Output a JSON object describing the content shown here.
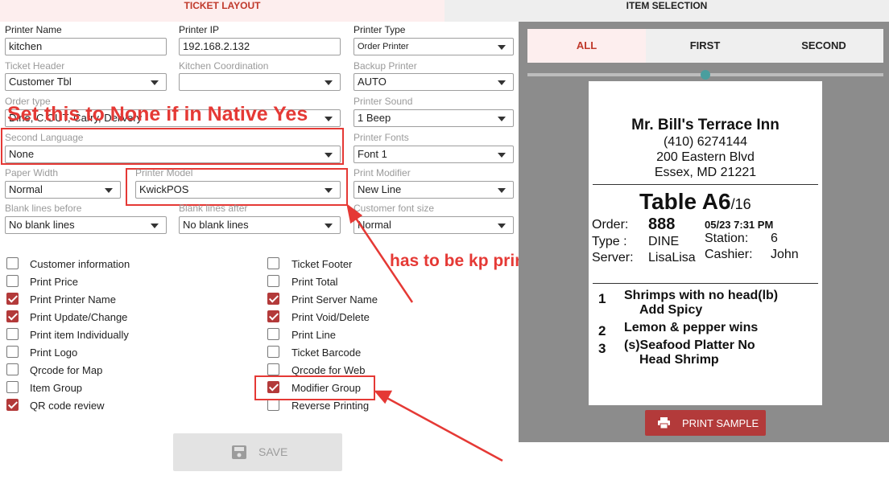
{
  "tabs": {
    "ticket_layout": "TICKET LAYOUT",
    "item_selection": "ITEM SELECTION"
  },
  "fields": {
    "printer_name": {
      "label": "Printer Name",
      "value": "kitchen"
    },
    "printer_ip": {
      "label": "Printer IP",
      "value": "192.168.2.132"
    },
    "printer_type": {
      "label": "Printer Type",
      "value": "Order Printer"
    },
    "ticket_header": {
      "label": "Ticket Header",
      "value": "Customer Tbl"
    },
    "kitchen_coordination": {
      "label": "Kitchen Coordination",
      "value": ""
    },
    "backup_printer": {
      "label": "Backup Printer",
      "value": "AUTO"
    },
    "order_type": {
      "label": "Order type",
      "value": "Dine, C.OUT, Carry, Delivery"
    },
    "printer_sound": {
      "label": "Printer Sound",
      "value": "1 Beep"
    },
    "second_language": {
      "label": "Second Language",
      "value": "None"
    },
    "printer_fonts": {
      "label": "Printer Fonts",
      "value": "Font 1"
    },
    "paper_width": {
      "label": "Paper Width",
      "value": "Normal"
    },
    "printer_model": {
      "label": "Printer Model",
      "value": "KwickPOS"
    },
    "print_modifier": {
      "label": "Print Modifier",
      "value": "New Line"
    },
    "blank_before": {
      "label": "Blank lines before",
      "value": "No blank lines"
    },
    "blank_after": {
      "label": "Blank lines after",
      "value": "No blank lines"
    },
    "customer_font": {
      "label": "Customer font size",
      "value": "Normal"
    }
  },
  "checkboxes_left": [
    {
      "label": "Customer information",
      "checked": false
    },
    {
      "label": "Print Price",
      "checked": false
    },
    {
      "label": "Print Printer Name",
      "checked": true
    },
    {
      "label": "Print Update/Change",
      "checked": true
    },
    {
      "label": "Print item Individually",
      "checked": false
    },
    {
      "label": "Print Logo",
      "checked": false
    },
    {
      "label": "Qrcode for Map",
      "checked": false
    },
    {
      "label": "Item Group",
      "checked": false
    },
    {
      "label": "QR code review",
      "checked": true
    }
  ],
  "checkboxes_right": [
    {
      "label": "Ticket Footer",
      "checked": false
    },
    {
      "label": "Print Total",
      "checked": false
    },
    {
      "label": "Print Server Name",
      "checked": true
    },
    {
      "label": "Print Void/Delete",
      "checked": true
    },
    {
      "label": "Print Line",
      "checked": false
    },
    {
      "label": "Ticket Barcode",
      "checked": false
    },
    {
      "label": "Qrcode for Web",
      "checked": false
    },
    {
      "label": "Modifier Group",
      "checked": true
    },
    {
      "label": "Reverse Printing",
      "checked": false
    }
  ],
  "save_label": "SAVE",
  "annotations": {
    "none_note": "Set this to None if in Native Yes",
    "kp_note": "has to be kp printer",
    "color": "#e53935"
  },
  "segments": [
    "ALL",
    "FIRST",
    "SECOND"
  ],
  "receipt": {
    "name": "Mr. Bill's Terrace Inn",
    "phone": "(410) 6274144",
    "address1": "200 Eastern Blvd",
    "address2": "Essex, MD 21221",
    "table": "Table A6",
    "table_suffix": "/16",
    "order_label": "Order:",
    "order_no": "888",
    "datetime": "05/23 7:31 PM",
    "type_label": "Type :",
    "type_value": "DINE",
    "station_label": "Station:",
    "station_value": "6",
    "server_label": "Server:",
    "server_value": "LisaLisa",
    "cashier_label": "Cashier:",
    "cashier_value": "John",
    "items": [
      {
        "qty": "1",
        "text": "Shrimps with no head(lb)"
      },
      {
        "qty": "",
        "text": "Add Spicy"
      },
      {
        "qty": "2",
        "text": "Lemon & pepper wins"
      },
      {
        "qty": "3",
        "text": "(s)Seafood Platter No"
      },
      {
        "qty": "",
        "text": "Head Shrimp"
      }
    ]
  },
  "print_sample_label": "PRINT SAMPLE",
  "colors": {
    "accent": "#b33a3a",
    "panel": "#8c8c8c"
  }
}
